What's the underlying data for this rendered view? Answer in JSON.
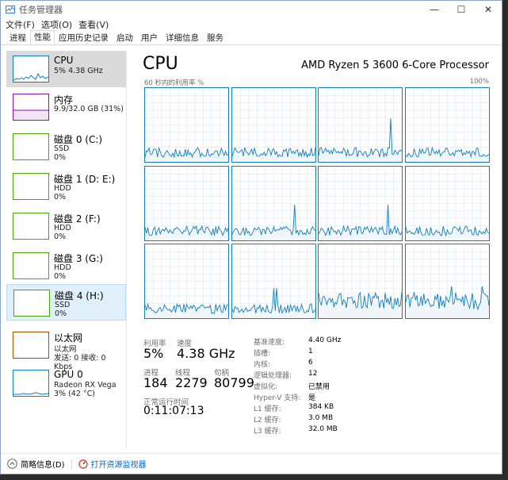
{
  "window": {
    "title": "任务管理器"
  },
  "controls": {
    "minimize": "—",
    "maximize": "☐",
    "close": "✕"
  },
  "menu": [
    "文件(F)",
    "选项(O)",
    "查看(V)"
  ],
  "tabs": [
    "进程",
    "性能",
    "应用历史记录",
    "启动",
    "用户",
    "详细信息",
    "服务"
  ],
  "sidebar": [
    {
      "title": "CPU",
      "lines": [
        "5% 4.38 GHz"
      ],
      "color": "#117dbb"
    },
    {
      "title": "内存",
      "lines": [
        "9.9/32.0 GB (31%)"
      ],
      "color": "#8b12ae"
    },
    {
      "title": "磁盘 0 (C:)",
      "lines": [
        "SSD",
        "0%"
      ],
      "color": "#4da60c"
    },
    {
      "title": "磁盘 1 (D: E:)",
      "lines": [
        "HDD",
        "0%"
      ],
      "color": "#4da60c"
    },
    {
      "title": "磁盘 2 (F:)",
      "lines": [
        "HDD",
        "0%"
      ],
      "color": "#4da60c"
    },
    {
      "title": "磁盘 3 (G:)",
      "lines": [
        "HDD",
        "0%"
      ],
      "color": "#4da60c"
    },
    {
      "title": "磁盘 4 (H:)",
      "lines": [
        "SSD",
        "0%"
      ],
      "color": "#4da60c"
    },
    {
      "title": "以太网",
      "lines": [
        "以太网",
        "发送: 0 接收: 0 Kbps"
      ],
      "color": "#a74f01"
    },
    {
      "title": "GPU 0",
      "lines": [
        "Radeon RX Vega",
        "3% (42 °C)"
      ],
      "color": "#117dbb"
    }
  ],
  "main": {
    "title": "CPU",
    "model": "AMD Ryzen 5 3600 6-Core Processor",
    "graph_label": "60 秒内的利用率 %",
    "graph_max": "100%"
  },
  "stats": {
    "util_label": "利用率",
    "util_value": "5%",
    "speed_label": "速度",
    "speed_value": "4.38 GHz",
    "proc_label": "进程",
    "proc_value": "184",
    "thread_label": "线程",
    "thread_value": "2279",
    "handle_label": "句柄",
    "handle_value": "80799",
    "uptime_label": "正常运行时间",
    "uptime_value": "0:11:07:13"
  },
  "specs": [
    {
      "k": "基准速度:",
      "v": "4.40 GHz"
    },
    {
      "k": "插槽:",
      "v": "1"
    },
    {
      "k": "内核:",
      "v": "6"
    },
    {
      "k": "逻辑处理器:",
      "v": "12"
    },
    {
      "k": "虚拟化:",
      "v": "已禁用"
    },
    {
      "k": "Hyper-V 支持:",
      "v": "是"
    },
    {
      "k": "L1 缓存:",
      "v": "384 KB"
    },
    {
      "k": "L2 缓存:",
      "v": "3.0 MB"
    },
    {
      "k": "L3 缓存:",
      "v": "32.0 MB"
    }
  ],
  "footer": {
    "brief": "简略信息(D)",
    "monitor": "打开资源监视器"
  },
  "colors": {
    "cpu": "#117dbb",
    "memory": "#8b12ae",
    "disk": "#4da60c",
    "ethernet": "#a74f01",
    "link": "#0066cc"
  }
}
